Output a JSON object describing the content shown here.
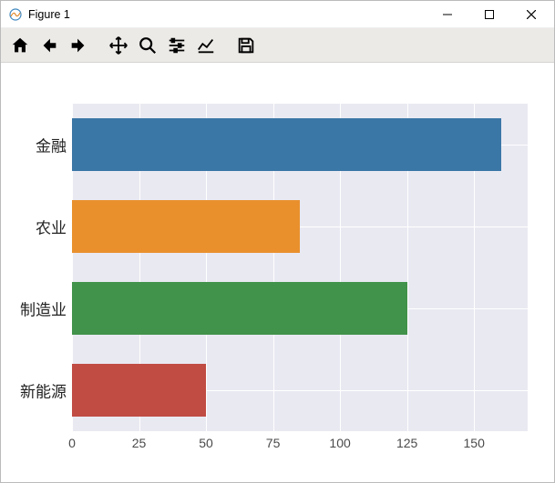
{
  "window": {
    "title": "Figure 1"
  },
  "toolbar": {
    "home": "Home",
    "back": "Back",
    "forward": "Forward",
    "pan": "Pan",
    "zoom": "Zoom",
    "configure": "Configure subplots",
    "edit": "Edit axis",
    "save": "Save"
  },
  "chart_data": {
    "type": "bar",
    "orientation": "horizontal",
    "categories": [
      "金融",
      "农业",
      "制造业",
      "新能源"
    ],
    "values": [
      160,
      85,
      125,
      50
    ],
    "xlim": [
      0,
      170
    ],
    "xticks": [
      0,
      25,
      50,
      75,
      100,
      125,
      150
    ],
    "colors": [
      "#3a76a6",
      "#e9902d",
      "#41924a",
      "#c04c44"
    ],
    "title": "",
    "xlabel": "",
    "ylabel": ""
  }
}
